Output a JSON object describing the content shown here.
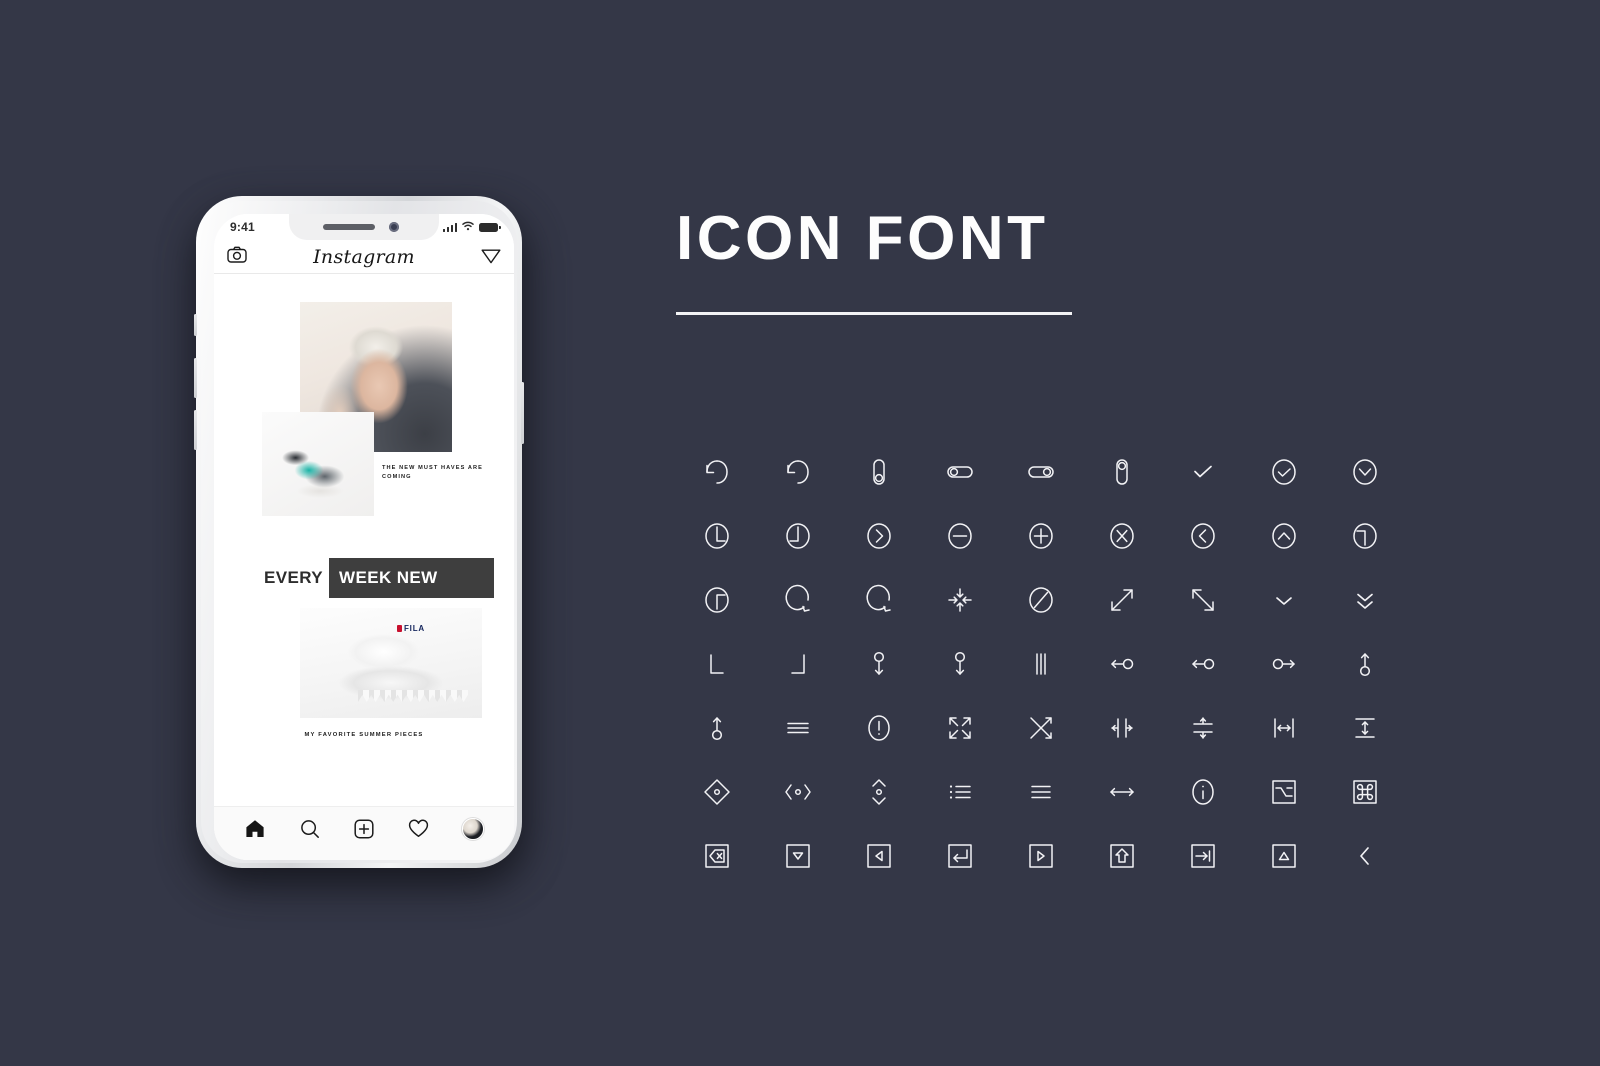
{
  "theme": {
    "background": "#343747",
    "icon_color": "#f2f2f5",
    "title_color": "#fdfdfd",
    "accent_dark": "#3e3e3e"
  },
  "panel": {
    "title": "ICON FONT"
  },
  "phone": {
    "status_bar": {
      "time": "9:41",
      "signal_icon": "signal-bars-icon",
      "wifi_icon": "wifi-icon",
      "battery_icon": "battery-icon"
    },
    "app_header": {
      "camera_icon": "camera-icon",
      "logo": "Instagram",
      "send_icon": "paper-plane-icon"
    },
    "feed": {
      "caption_1": "THE NEW MUST HAVES ARE COMING",
      "promo_left": "EVERY",
      "promo_right": "WEEK NEW",
      "brand_logo": "FILA",
      "caption_2": "MY FAVORITE SUMMER PIECES"
    },
    "tabbar": {
      "items": [
        {
          "name": "home-icon",
          "label": "Home"
        },
        {
          "name": "search-icon",
          "label": "Search"
        },
        {
          "name": "add-post-icon",
          "label": "Add post"
        },
        {
          "name": "heart-icon",
          "label": "Activity"
        },
        {
          "name": "avatar-icon",
          "label": "Profile"
        }
      ]
    }
  },
  "icons": {
    "columns": 9,
    "rows": 7,
    "list": [
      "rotate-counterclockwise-icon",
      "rotate-clockwise-icon",
      "toggle-vertical-off-icon",
      "toggle-left-icon",
      "toggle-right-icon",
      "toggle-vertical-on-icon",
      "check-icon",
      "check-circle-icon",
      "chevron-down-circle-icon",
      "corner-down-left-circle-icon",
      "corner-down-right-circle-icon",
      "chevron-right-circle-icon",
      "minus-circle-icon",
      "plus-circle-icon",
      "x-circle-icon",
      "chevron-left-circle-icon",
      "chevron-up-circle-icon",
      "corner-up-left-circle-icon",
      "corner-up-right-circle-icon",
      "refresh-counterclockwise-icon",
      "refresh-clockwise-icon",
      "collapse-icon",
      "slash-circle-icon",
      "arrow-diagonal-up-right-icon",
      "arrow-diagonal-down-right-icon",
      "chevron-down-icon",
      "chevrons-down-icon",
      "corner-bottom-left-icon",
      "corner-bottom-right-icon",
      "circle-arrow-down-icon",
      "circle-arrow-down-alt-icon",
      "three-vertical-lines-icon",
      "arrow-left-circle-end-icon",
      "arrow-left-circle-end-alt-icon",
      "circle-arrow-right-end-icon",
      "circle-arrow-up-end-icon",
      "circle-arrow-up-icon",
      "menu-lines-icon",
      "alert-circle-icon",
      "maximize-icon",
      "shuffle-icon",
      "distribute-horizontal-icon",
      "distribute-vertical-icon",
      "measure-width-icon",
      "measure-height-icon",
      "diamond-dot-icon",
      "angle-brackets-dot-icon",
      "chevrons-up-down-dot-icon",
      "list-icon",
      "hamburger-icon",
      "arrows-horizontal-icon",
      "info-circle-icon",
      "option-key-icon",
      "command-key-icon",
      "backspace-key-icon",
      "dropdown-key-icon",
      "left-key-icon",
      "enter-key-icon",
      "play-key-icon",
      "shift-key-icon",
      "tab-key-icon",
      "caps-key-icon",
      "chevron-left-icon"
    ]
  }
}
